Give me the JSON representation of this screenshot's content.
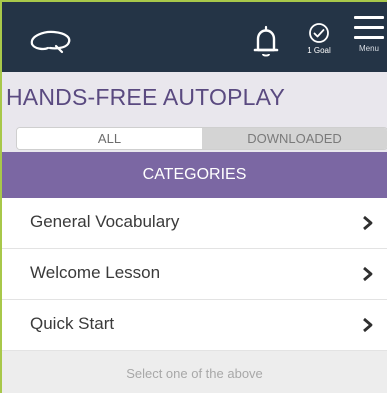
{
  "header": {
    "goal_label": "1 Goal",
    "menu_label": "Menu",
    "icons": [
      "logo-icon",
      "bell-icon",
      "goal-check-icon",
      "menu-icon"
    ]
  },
  "page": {
    "title": "HANDS-FREE AUTOPLAY"
  },
  "tabs": [
    {
      "label": "ALL",
      "selected": true
    },
    {
      "label": "DOWNLOADED",
      "selected": false
    }
  ],
  "categories": {
    "header": "CATEGORIES",
    "items": [
      {
        "label": "General Vocabulary"
      },
      {
        "label": "Welcome Lesson"
      },
      {
        "label": "Quick Start"
      }
    ]
  },
  "footer": {
    "hint": "Select one of the above"
  },
  "colors": {
    "topbar": "#243446",
    "title": "#5a4a80",
    "categories_header": "#7b67a3",
    "frame_border": "#a8c84a"
  }
}
